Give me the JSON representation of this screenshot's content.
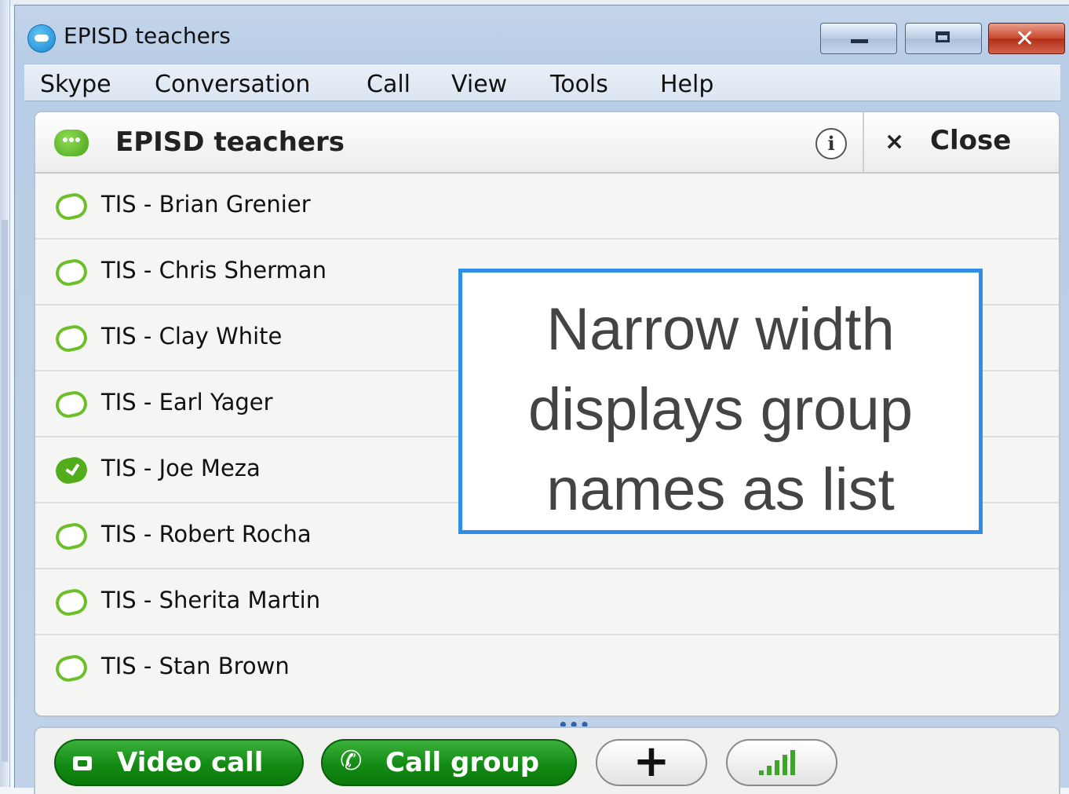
{
  "window": {
    "title": "EPISD teachers",
    "controls": {
      "minimize": "minimize",
      "maximize": "maximize",
      "close": "close"
    }
  },
  "menu": [
    "Skype",
    "Conversation",
    "Call",
    "View",
    "Tools",
    "Help"
  ],
  "conversation": {
    "title": "EPISD teachers",
    "info_label": "i",
    "close_symbol": "×",
    "close_label": "Close",
    "members": [
      {
        "name": "TIS - Brian Grenier",
        "status": "offline"
      },
      {
        "name": "TIS - Chris Sherman",
        "status": "offline"
      },
      {
        "name": "TIS - Clay White",
        "status": "offline"
      },
      {
        "name": "TIS - Earl Yager",
        "status": "offline"
      },
      {
        "name": "TIS - Joe Meza",
        "status": "online"
      },
      {
        "name": "TIS - Robert Rocha",
        "status": "offline"
      },
      {
        "name": "TIS - Sherita Martin",
        "status": "offline"
      },
      {
        "name": "TIS - Stan Brown",
        "status": "offline"
      }
    ]
  },
  "annotation": {
    "lines": [
      "Narrow width",
      "displays group",
      "names as list"
    ]
  },
  "resize_handle": "•••",
  "toolbar": {
    "video_call": "Video call",
    "call_group": "Call group",
    "add": "+",
    "call_quality_icon": "signal-bars-icon"
  },
  "colors": {
    "accent_blue": "#2f8fe8",
    "button_green": "#138a13",
    "status_green": "#6dbf29"
  }
}
